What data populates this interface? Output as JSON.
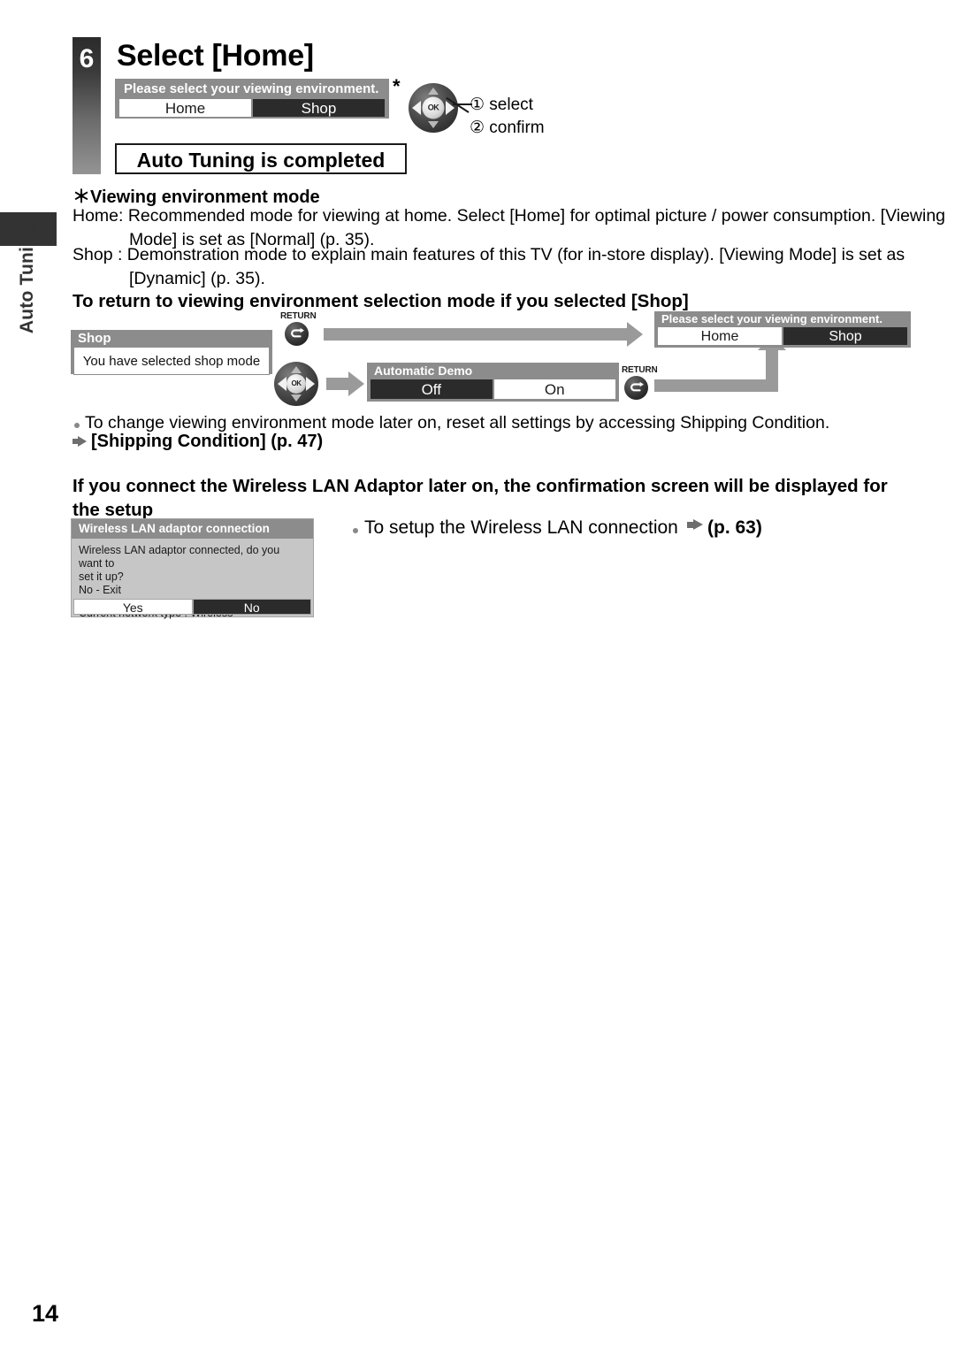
{
  "sidebar": {
    "chapter_label": "Auto Tuning"
  },
  "step": {
    "number": "6",
    "title": "Select [Home]"
  },
  "dialog_env_top": {
    "title": "Please select your viewing environment.",
    "option_home": "Home",
    "option_shop": "Shop",
    "asterisk": "*"
  },
  "remote": {
    "ok_label": "OK",
    "return_label": "RETURN",
    "callout_select": "① select",
    "callout_confirm": "② confirm"
  },
  "auto_complete_banner": "Auto Tuning is completed",
  "viewing_mode": {
    "heading": "＊Viewing environment mode",
    "home_line": "Home: Recommended mode for viewing at home. Select [Home] for optimal picture / power consumption. [Viewing Mode] is set as [Normal] (p. 35).",
    "shop_line": "Shop : Demonstration mode to explain main features of this TV (for in-store display). [Viewing Mode] is set as [Dynamic] (p. 35)."
  },
  "return_section": {
    "heading": "To return to viewing environment selection mode if you selected [Shop]",
    "dialog_shop": {
      "title": "Shop",
      "message": "You have selected shop mode"
    },
    "dialog_demo": {
      "title": "Automatic Demo",
      "option_off": "Off",
      "option_on": "On"
    },
    "dialog_env_right": {
      "title": "Please select your viewing environment.",
      "option_home": "Home",
      "option_shop": "Shop"
    }
  },
  "notes": {
    "change_mode": "To change viewing environment mode later on, reset all settings by accessing Shipping Condition.",
    "shipping_condition_ref": "[Shipping Condition] (p. 47)"
  },
  "wireless": {
    "heading": "If you connect the Wireless LAN Adaptor later on, the confirmation screen will be displayed for the setup",
    "dialog": {
      "title": "Wireless LAN adaptor connection",
      "body_line1": "Wireless LAN adaptor connected, do you want to",
      "body_line2": "set it up?",
      "body_line3": "No - Exit",
      "network_type": "Current network type : Wireless",
      "option_yes": "Yes",
      "option_no": "No"
    },
    "setup_note": "To setup the Wireless LAN connection",
    "setup_ref": "(p. 63)"
  },
  "footer": {
    "page_number": "14"
  }
}
